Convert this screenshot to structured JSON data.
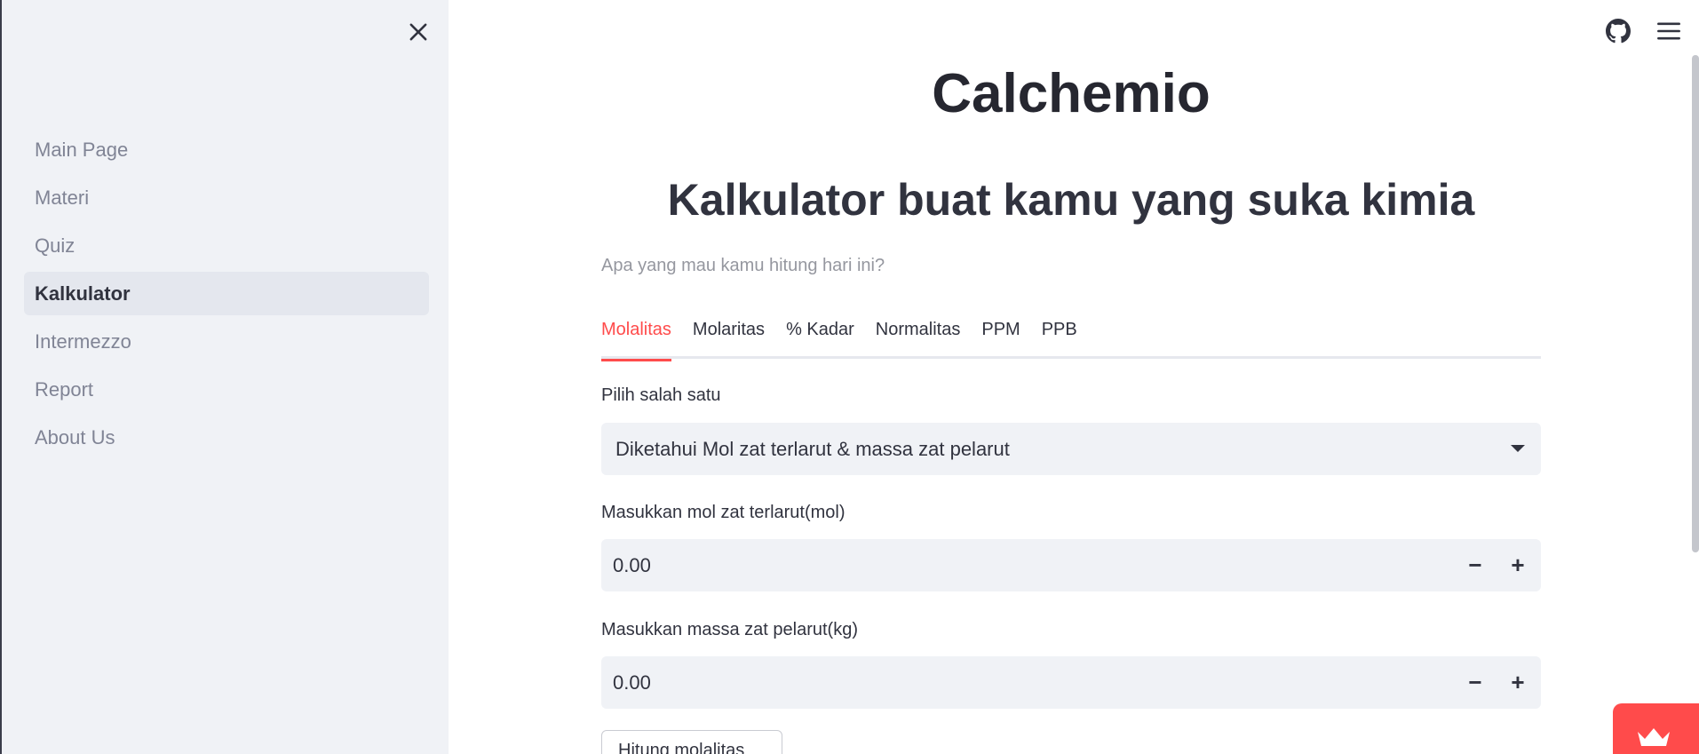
{
  "sidebar": {
    "items": [
      {
        "label": "Main Page"
      },
      {
        "label": "Materi"
      },
      {
        "label": "Quiz"
      },
      {
        "label": "Kalkulator"
      },
      {
        "label": "Intermezzo"
      },
      {
        "label": "Report"
      },
      {
        "label": "About Us"
      }
    ],
    "active": "Kalkulator",
    "close_icon": "close-icon"
  },
  "header": {
    "github_icon": "github-icon",
    "menu_icon": "hamburger-menu-icon"
  },
  "main": {
    "title": "Calchemio",
    "subtitle": "Kalkulator buat kamu yang suka kimia",
    "caption": "Apa yang mau kamu hitung hari ini?",
    "tabs": [
      {
        "label": "Molalitas"
      },
      {
        "label": "Molaritas"
      },
      {
        "label": "% Kadar"
      },
      {
        "label": "Normalitas"
      },
      {
        "label": "PPM"
      },
      {
        "label": "PPB"
      }
    ],
    "active_tab": "Molalitas",
    "select": {
      "label": "Pilih salah satu",
      "value": "Diketahui Mol zat terlarut & massa zat pelarut"
    },
    "mol_input": {
      "label": "Masukkan mol zat terlarut(mol)",
      "value": "0.00"
    },
    "massa_input": {
      "label": "Masukkan massa zat pelarut(kg)",
      "value": "0.00"
    },
    "button_label": "Hitung molalitas",
    "minus": "−",
    "plus": "+"
  },
  "colors": {
    "accent": "#ff4b4b",
    "sidebar_bg": "#f0f2f6"
  }
}
